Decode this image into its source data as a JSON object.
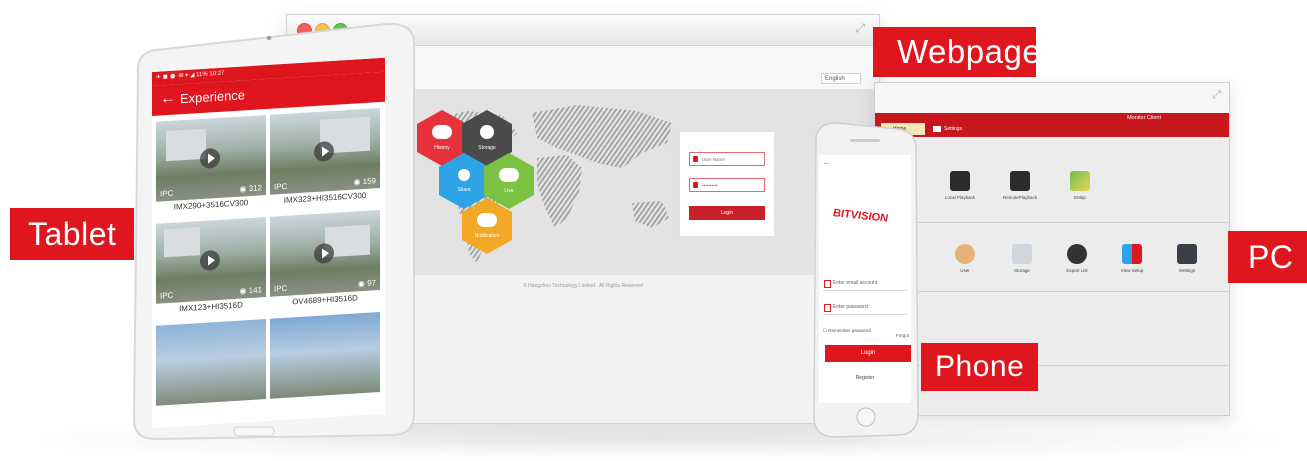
{
  "labels": {
    "webpage": "Webpage",
    "tablet": "Tablet",
    "pc": "PC",
    "phone": "Phone"
  },
  "colors": {
    "brand_red": "#e0161f",
    "hex_red": "#e5323b",
    "hex_dark": "#4a4a4a",
    "hex_blue": "#2ea3e6",
    "hex_green": "#7cc242",
    "hex_orange": "#f2a824"
  },
  "webpage": {
    "language": "English",
    "hexagons": [
      {
        "label": "History",
        "icon": "cloud-icon"
      },
      {
        "label": "Storage",
        "icon": "download-icon"
      },
      {
        "label": "Share",
        "icon": "share-icon"
      },
      {
        "label": "Live",
        "icon": "cloud-icon"
      },
      {
        "label": "Notification",
        "icon": "chat-icon"
      }
    ],
    "login": {
      "username_placeholder": "User Name",
      "password_value": "••••••••••",
      "login_label": "Login"
    },
    "footer": "© Hangzhou Technology Limited . All Rights Reserved"
  },
  "pc_client": {
    "title": "Monitor Client",
    "menu": {
      "home": "Home",
      "settings": "Settings"
    },
    "row1": [
      {
        "label": "Local Playback",
        "icon": "clapper-icon"
      },
      {
        "label": "RemotePlayback",
        "icon": "clapper-icon"
      },
      {
        "label": "EMap",
        "icon": "map-icon"
      }
    ],
    "row2": [
      {
        "label": "User",
        "icon": "user-icon"
      },
      {
        "label": "Storage",
        "icon": "camera-icon"
      },
      {
        "label": "Export List",
        "icon": "film-reel-icon"
      },
      {
        "label": "View Setup",
        "icon": "grid-icon"
      },
      {
        "label": "Settings",
        "icon": "monitor-icon"
      }
    ]
  },
  "tablet": {
    "status": "✈ ◼        ⏰ ✉ ▾ ◢ 11% 10:27",
    "title": "Experience",
    "cards": [
      {
        "type": "IPC",
        "views": "312",
        "caption": "IMX290+3516CV300"
      },
      {
        "type": "IPC",
        "views": "159",
        "caption": "IMX323+HI3516CV300"
      },
      {
        "type": "IPC",
        "views": "141",
        "caption": "IMX123+HI3516D"
      },
      {
        "type": "IPC",
        "views": "97",
        "caption": "OV4689+HI3516D"
      }
    ]
  },
  "phone": {
    "brand": "BITVISION",
    "username_placeholder": "Enter email account",
    "password_placeholder": "Enter password",
    "remember": "Remember password",
    "forgot": "Forgot",
    "login_label": "Login",
    "register": "Register"
  }
}
